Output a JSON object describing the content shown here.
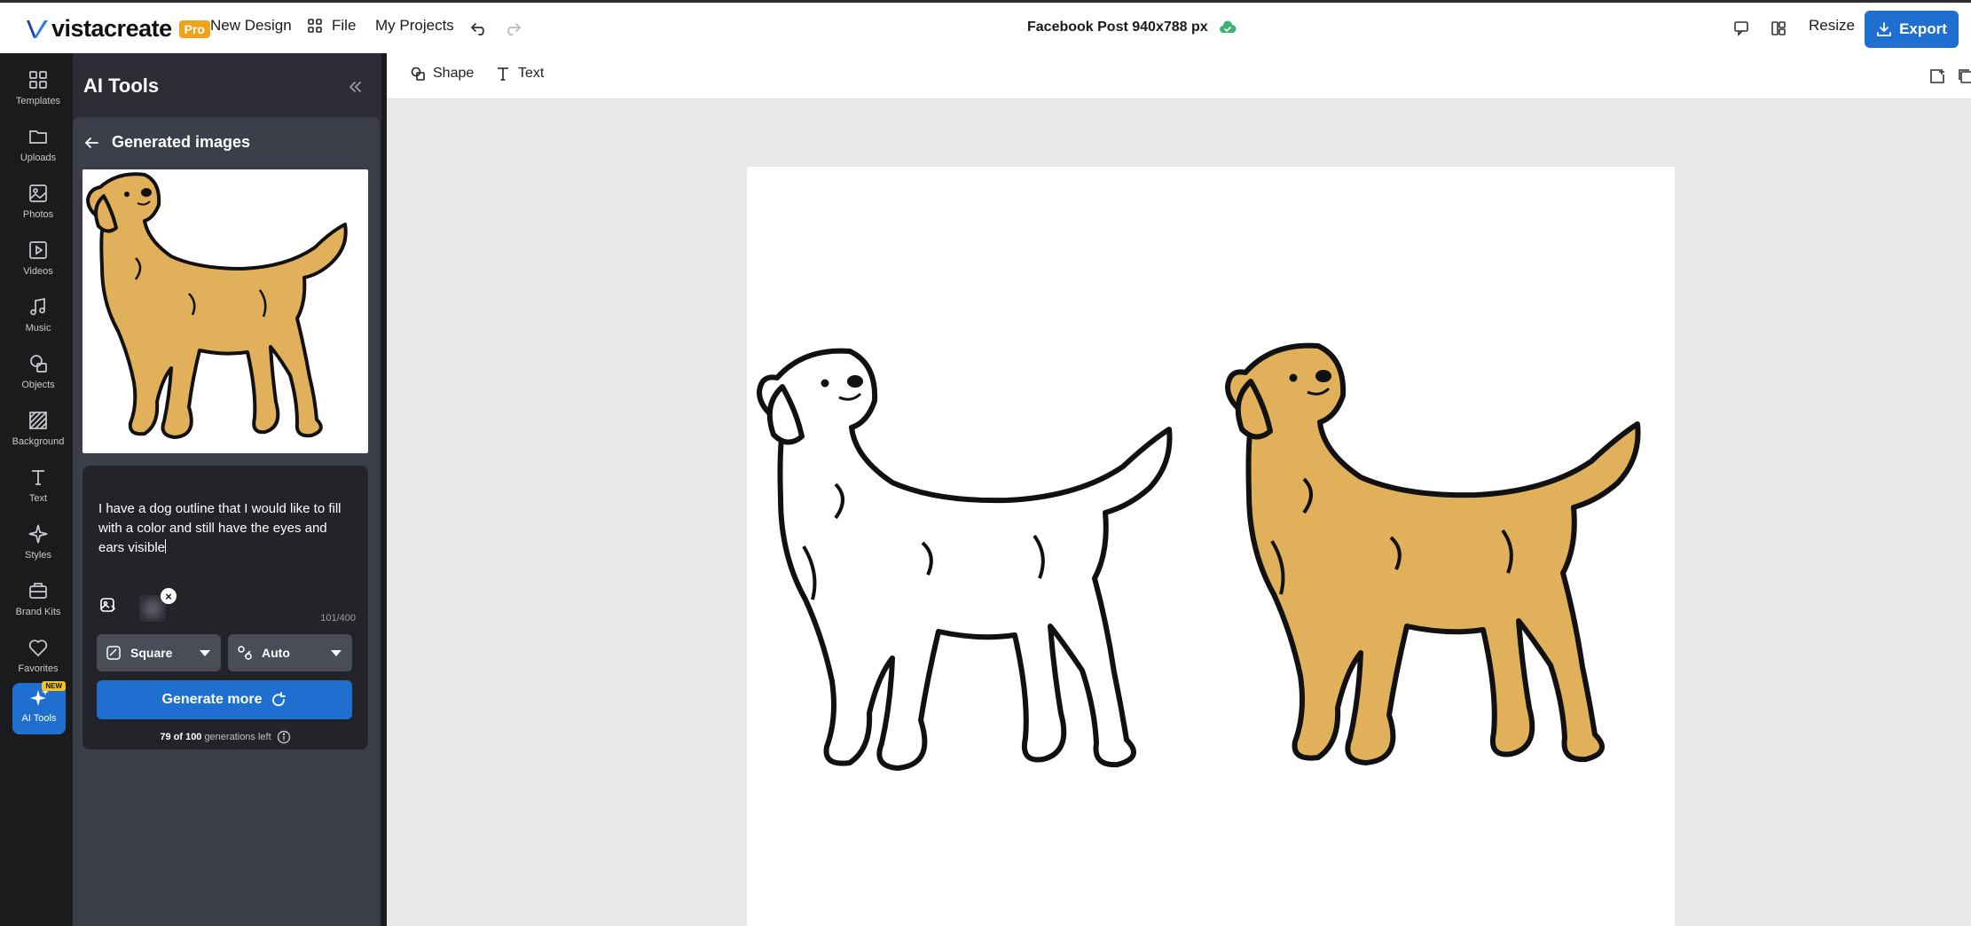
{
  "header": {
    "logo_text": "vistacreate",
    "pro_badge": "Pro",
    "new_design": "New Design",
    "file": "File",
    "my_projects": "My Projects",
    "doc_title": "Facebook Post 940x788 px",
    "resize": "Resize",
    "export": "Export"
  },
  "rail": {
    "items": [
      {
        "label": "Templates",
        "icon": "templates-icon"
      },
      {
        "label": "Uploads",
        "icon": "uploads-icon"
      },
      {
        "label": "Photos",
        "icon": "photos-icon"
      },
      {
        "label": "Videos",
        "icon": "videos-icon"
      },
      {
        "label": "Music",
        "icon": "music-icon"
      },
      {
        "label": "Objects",
        "icon": "objects-icon"
      },
      {
        "label": "Background",
        "icon": "background-icon"
      },
      {
        "label": "Text",
        "icon": "text-icon"
      },
      {
        "label": "Styles",
        "icon": "styles-icon"
      },
      {
        "label": "Brand Kits",
        "icon": "brand-kits-icon"
      },
      {
        "label": "Favorites",
        "icon": "favorites-icon"
      },
      {
        "label": "AI Tools",
        "icon": "ai-tools-icon"
      }
    ],
    "new_badge": "NEW",
    "active": "AI Tools"
  },
  "panel": {
    "title": "AI Tools",
    "section_title": "Generated images",
    "prompt": "I have a dog outline that I would like to fill with a color and still have the eyes and ears visible",
    "char_count": "101/400",
    "shape_option": "Square",
    "style_option": "Auto",
    "generate_label": "Generate more",
    "generations_used": "79 of 100",
    "generations_suffix": "generations left"
  },
  "toolbar": {
    "shape": "Shape",
    "text": "Text"
  },
  "colors": {
    "accent": "#1f6fd1",
    "dog_fill": "#e0b15a",
    "panel_bg": "#2b2c34",
    "pro_badge": "#f0a21a"
  }
}
